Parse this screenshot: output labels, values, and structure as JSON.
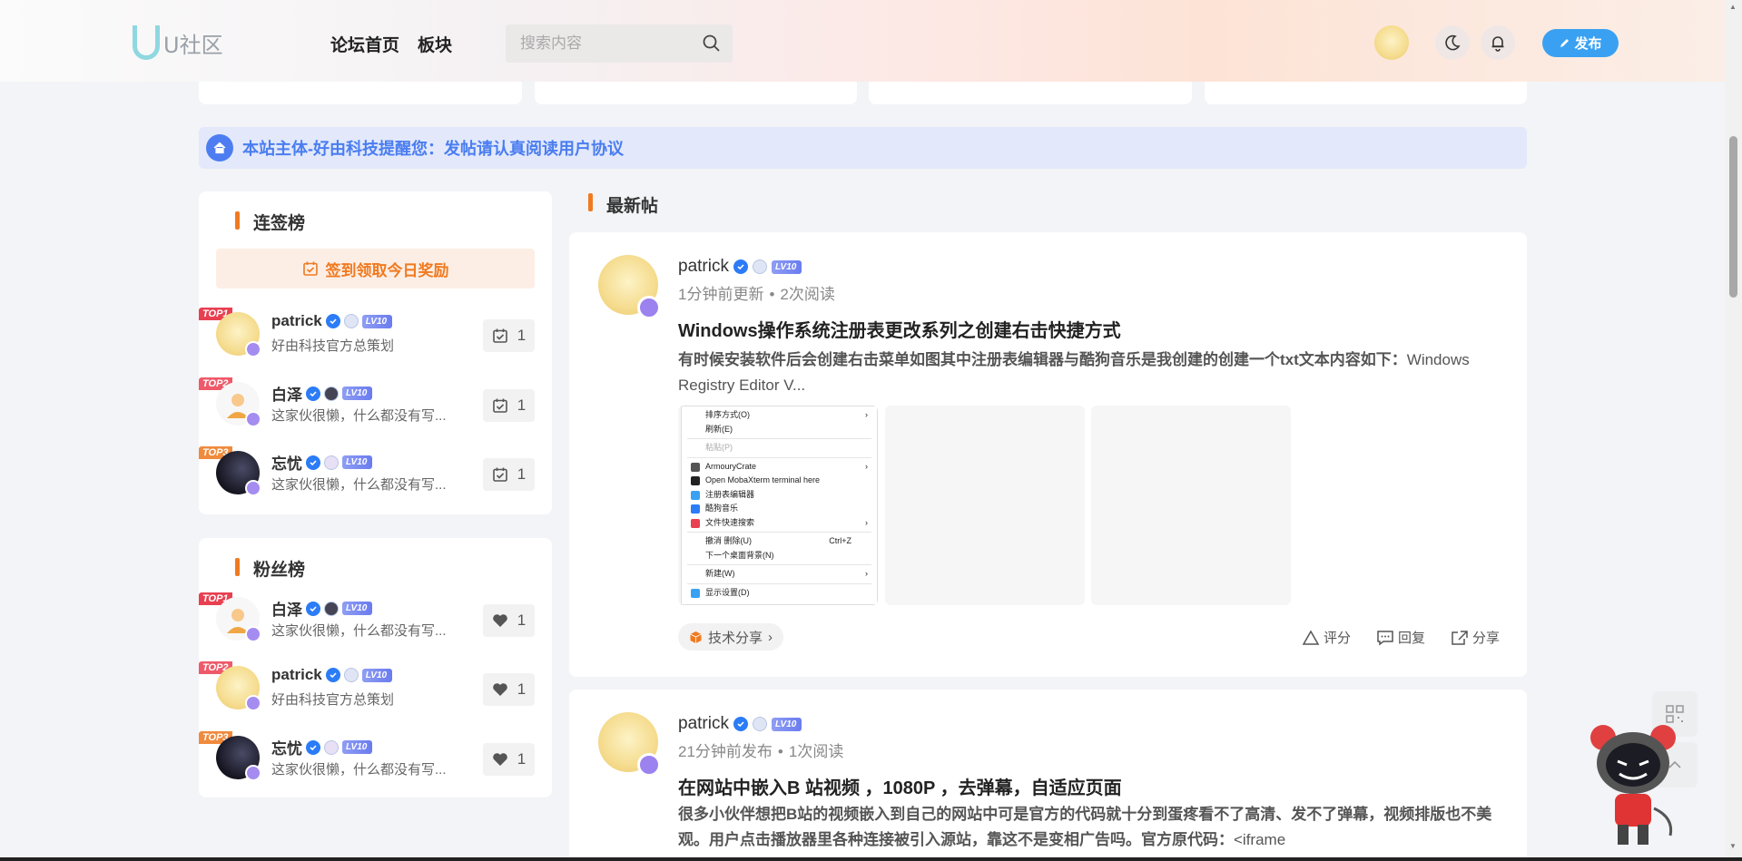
{
  "header": {
    "logo_text": "U社区",
    "nav": [
      "论坛首页",
      "板块"
    ],
    "search_placeholder": "搜索内容",
    "publish_label": "发布"
  },
  "notice": {
    "text": "本站主体-好由科技提醒您：发帖请认真阅读用户协议"
  },
  "checkin_board": {
    "title": "连签榜",
    "checkin_button": "签到领取今日奖励",
    "items": [
      {
        "rank": "TOP1",
        "name": "patrick",
        "level": "LV10",
        "desc": "好由科技官方总策划",
        "count": "1"
      },
      {
        "rank": "TOP2",
        "name": "白泽",
        "level": "LV10",
        "desc": "这家伙很懒，什么都没有写...",
        "count": "1"
      },
      {
        "rank": "TOP3",
        "name": "忘忧",
        "level": "LV10",
        "desc": "这家伙很懒，什么都没有写...",
        "count": "1"
      }
    ]
  },
  "fans_board": {
    "title": "粉丝榜",
    "items": [
      {
        "rank": "TOP1",
        "name": "白泽",
        "level": "LV10",
        "desc": "这家伙很懒，什么都没有写...",
        "count": "1"
      },
      {
        "rank": "TOP2",
        "name": "patrick",
        "level": "LV10",
        "desc": "好由科技官方总策划",
        "count": "1"
      },
      {
        "rank": "TOP3",
        "name": "忘忧",
        "level": "LV10",
        "desc": "这家伙很懒，什么都没有写...",
        "count": "1"
      }
    ]
  },
  "feed": {
    "title": "最新帖",
    "posts": [
      {
        "author": "patrick",
        "level": "LV10",
        "time": "1分钟前更新",
        "views": "2次阅读",
        "title": "Windows操作系统注册表更改系列之创建右击快捷方式",
        "excerpt_bold": "有时候安装软件后会创建右击菜单如图其中注册表编辑器与酷狗音乐是我创建的创建一个txt文本内容如下：",
        "excerpt_plain": "Windows Registry Editor V...",
        "context_menu": [
          "排序方式(O)",
          "刷新(E)",
          "粘贴(P)",
          "ArmouryCrate",
          "Open MobaXterm terminal here",
          "注册表编辑器",
          "酷狗音乐",
          "文件快速搜索",
          "撤消 删除(U)",
          "Ctrl+Z",
          "下一个桌面背景(N)",
          "新建(W)",
          "显示设置(D)"
        ],
        "tag": "技术分享",
        "actions": [
          "评分",
          "回复",
          "分享"
        ]
      },
      {
        "author": "patrick",
        "level": "LV10",
        "time": "21分钟前发布",
        "views": "1次阅读",
        "title": "在网站中嵌入B 站视频 ，1080P ，去弹幕，自适应页面",
        "excerpt_bold": "很多小伙伴想把B站的视频嵌入到自己的网站中可是官方的代码就十分到蛋疼看不了高清、发不了弹幕，视频排版也不美观。用户点击播放器里各种连接被引入源站，靠这不是变相广告吗。官方原代码：",
        "excerpt_plain": "<iframe"
      }
    ]
  },
  "colors": {
    "accent": "#f07a20",
    "primary": "#3aa1f2",
    "notice": "#4a7df0"
  }
}
